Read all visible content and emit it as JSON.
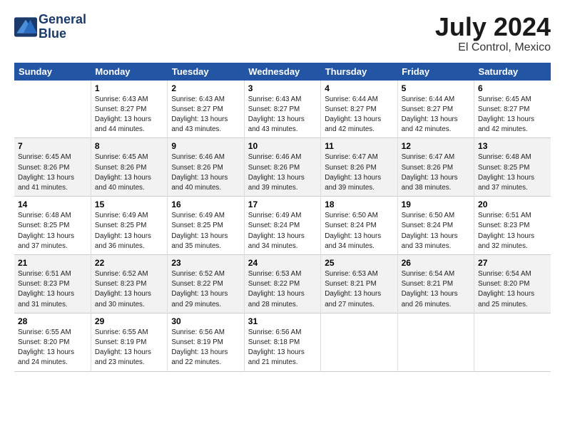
{
  "logo": {
    "line1": "General",
    "line2": "Blue"
  },
  "title": "July 2024",
  "location": "El Control, Mexico",
  "days_header": [
    "Sunday",
    "Monday",
    "Tuesday",
    "Wednesday",
    "Thursday",
    "Friday",
    "Saturday"
  ],
  "weeks": [
    [
      {
        "day": "",
        "info": ""
      },
      {
        "day": "1",
        "info": "Sunrise: 6:43 AM\nSunset: 8:27 PM\nDaylight: 13 hours\nand 44 minutes."
      },
      {
        "day": "2",
        "info": "Sunrise: 6:43 AM\nSunset: 8:27 PM\nDaylight: 13 hours\nand 43 minutes."
      },
      {
        "day": "3",
        "info": "Sunrise: 6:43 AM\nSunset: 8:27 PM\nDaylight: 13 hours\nand 43 minutes."
      },
      {
        "day": "4",
        "info": "Sunrise: 6:44 AM\nSunset: 8:27 PM\nDaylight: 13 hours\nand 42 minutes."
      },
      {
        "day": "5",
        "info": "Sunrise: 6:44 AM\nSunset: 8:27 PM\nDaylight: 13 hours\nand 42 minutes."
      },
      {
        "day": "6",
        "info": "Sunrise: 6:45 AM\nSunset: 8:27 PM\nDaylight: 13 hours\nand 42 minutes."
      }
    ],
    [
      {
        "day": "7",
        "info": "Sunrise: 6:45 AM\nSunset: 8:26 PM\nDaylight: 13 hours\nand 41 minutes."
      },
      {
        "day": "8",
        "info": "Sunrise: 6:45 AM\nSunset: 8:26 PM\nDaylight: 13 hours\nand 40 minutes."
      },
      {
        "day": "9",
        "info": "Sunrise: 6:46 AM\nSunset: 8:26 PM\nDaylight: 13 hours\nand 40 minutes."
      },
      {
        "day": "10",
        "info": "Sunrise: 6:46 AM\nSunset: 8:26 PM\nDaylight: 13 hours\nand 39 minutes."
      },
      {
        "day": "11",
        "info": "Sunrise: 6:47 AM\nSunset: 8:26 PM\nDaylight: 13 hours\nand 39 minutes."
      },
      {
        "day": "12",
        "info": "Sunrise: 6:47 AM\nSunset: 8:26 PM\nDaylight: 13 hours\nand 38 minutes."
      },
      {
        "day": "13",
        "info": "Sunrise: 6:48 AM\nSunset: 8:25 PM\nDaylight: 13 hours\nand 37 minutes."
      }
    ],
    [
      {
        "day": "14",
        "info": "Sunrise: 6:48 AM\nSunset: 8:25 PM\nDaylight: 13 hours\nand 37 minutes."
      },
      {
        "day": "15",
        "info": "Sunrise: 6:49 AM\nSunset: 8:25 PM\nDaylight: 13 hours\nand 36 minutes."
      },
      {
        "day": "16",
        "info": "Sunrise: 6:49 AM\nSunset: 8:25 PM\nDaylight: 13 hours\nand 35 minutes."
      },
      {
        "day": "17",
        "info": "Sunrise: 6:49 AM\nSunset: 8:24 PM\nDaylight: 13 hours\nand 34 minutes."
      },
      {
        "day": "18",
        "info": "Sunrise: 6:50 AM\nSunset: 8:24 PM\nDaylight: 13 hours\nand 34 minutes."
      },
      {
        "day": "19",
        "info": "Sunrise: 6:50 AM\nSunset: 8:24 PM\nDaylight: 13 hours\nand 33 minutes."
      },
      {
        "day": "20",
        "info": "Sunrise: 6:51 AM\nSunset: 8:23 PM\nDaylight: 13 hours\nand 32 minutes."
      }
    ],
    [
      {
        "day": "21",
        "info": "Sunrise: 6:51 AM\nSunset: 8:23 PM\nDaylight: 13 hours\nand 31 minutes."
      },
      {
        "day": "22",
        "info": "Sunrise: 6:52 AM\nSunset: 8:23 PM\nDaylight: 13 hours\nand 30 minutes."
      },
      {
        "day": "23",
        "info": "Sunrise: 6:52 AM\nSunset: 8:22 PM\nDaylight: 13 hours\nand 29 minutes."
      },
      {
        "day": "24",
        "info": "Sunrise: 6:53 AM\nSunset: 8:22 PM\nDaylight: 13 hours\nand 28 minutes."
      },
      {
        "day": "25",
        "info": "Sunrise: 6:53 AM\nSunset: 8:21 PM\nDaylight: 13 hours\nand 27 minutes."
      },
      {
        "day": "26",
        "info": "Sunrise: 6:54 AM\nSunset: 8:21 PM\nDaylight: 13 hours\nand 26 minutes."
      },
      {
        "day": "27",
        "info": "Sunrise: 6:54 AM\nSunset: 8:20 PM\nDaylight: 13 hours\nand 25 minutes."
      }
    ],
    [
      {
        "day": "28",
        "info": "Sunrise: 6:55 AM\nSunset: 8:20 PM\nDaylight: 13 hours\nand 24 minutes."
      },
      {
        "day": "29",
        "info": "Sunrise: 6:55 AM\nSunset: 8:19 PM\nDaylight: 13 hours\nand 23 minutes."
      },
      {
        "day": "30",
        "info": "Sunrise: 6:56 AM\nSunset: 8:19 PM\nDaylight: 13 hours\nand 22 minutes."
      },
      {
        "day": "31",
        "info": "Sunrise: 6:56 AM\nSunset: 8:18 PM\nDaylight: 13 hours\nand 21 minutes."
      },
      {
        "day": "",
        "info": ""
      },
      {
        "day": "",
        "info": ""
      },
      {
        "day": "",
        "info": ""
      }
    ]
  ]
}
